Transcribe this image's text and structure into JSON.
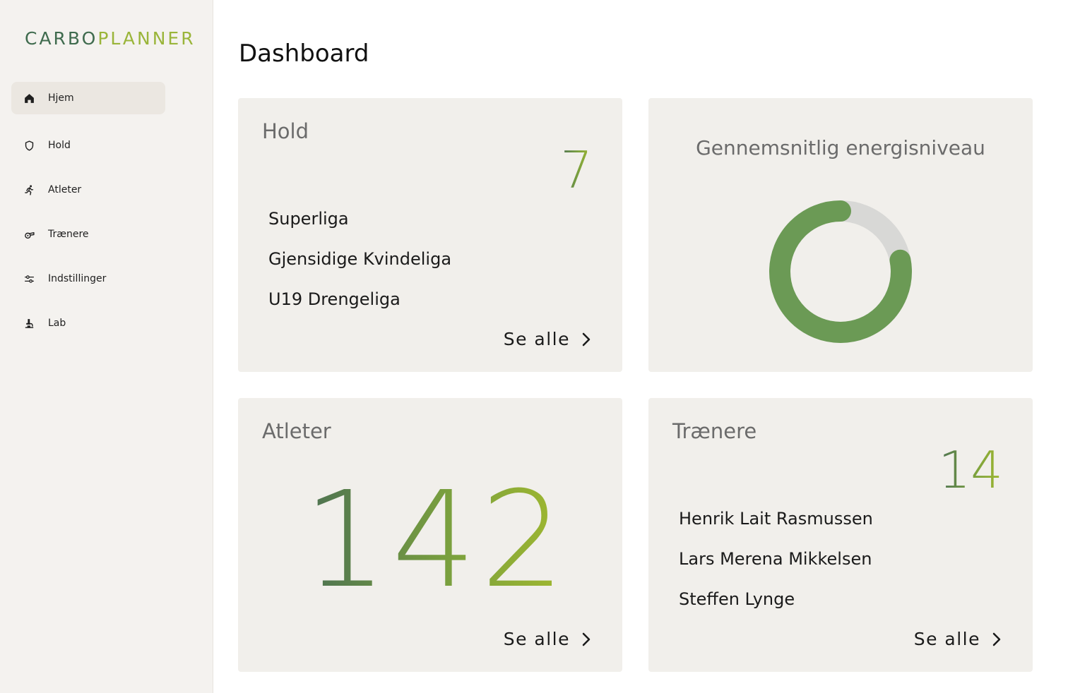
{
  "brand": {
    "part1": "CARBO",
    "part2": "PLANNER"
  },
  "sidebar": {
    "items": [
      {
        "label": "Hjem",
        "icon": "home-icon",
        "active": true
      },
      {
        "label": "Hold",
        "icon": "shield-icon",
        "active": false
      },
      {
        "label": "Atleter",
        "icon": "runner-icon",
        "active": false
      },
      {
        "label": "Trænere",
        "icon": "whistle-icon",
        "active": false
      },
      {
        "label": "Indstillinger",
        "icon": "sliders-icon",
        "active": false
      },
      {
        "label": "Lab",
        "icon": "microscope-icon",
        "active": false
      }
    ]
  },
  "main": {
    "title": "Dashboard",
    "teams_card": {
      "title": "Hold",
      "count": "7",
      "items": [
        "Superliga",
        "Gjensidige Kvindeliga",
        "U19 Drengeliga"
      ],
      "see_all": "Se alle"
    },
    "energy_card": {
      "title": "Gennemsnitlig energisniveau",
      "level": 0.78,
      "colors": {
        "fill": "#6b9a55",
        "track": "#d8d8d6"
      }
    },
    "athletes_card": {
      "title": "Atleter",
      "count": "142",
      "see_all": "Se alle"
    },
    "coaches_card": {
      "title": "Trænere",
      "count": "14",
      "items": [
        "Henrik Lait Rasmussen",
        "Lars Merena Mikkelsen",
        "Steffen Lynge"
      ],
      "see_all": "Se alle"
    }
  },
  "colors": {
    "sidebar_bg": "#f4f2ef",
    "card_bg": "#f1efeb",
    "brand_dark": "#3f6b4e",
    "brand_light": "#9ab53a"
  }
}
